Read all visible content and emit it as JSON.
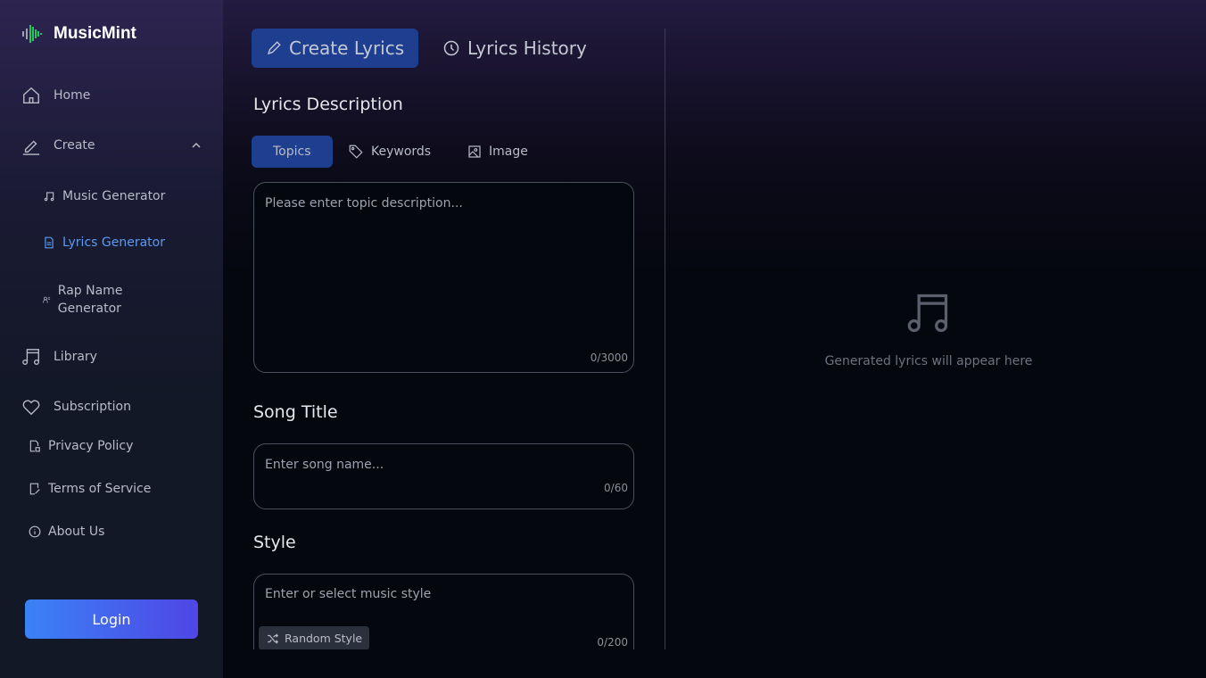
{
  "app": {
    "name": "MusicMint"
  },
  "sidebar": {
    "items": [
      {
        "label": "Home"
      },
      {
        "label": "Create"
      },
      {
        "label": "Music Generator"
      },
      {
        "label": "Lyrics Generator"
      },
      {
        "label": "Rap Name Generator"
      },
      {
        "label": "Library"
      },
      {
        "label": "Subscription"
      },
      {
        "label": "Privacy Policy"
      },
      {
        "label": "Terms of Service"
      },
      {
        "label": "About Us"
      }
    ],
    "login": "Login"
  },
  "tabs": [
    {
      "label": "Create Lyrics"
    },
    {
      "label": "Lyrics History"
    }
  ],
  "form": {
    "description_title": "Lyrics Description",
    "subtabs": [
      {
        "label": "Topics"
      },
      {
        "label": "Keywords"
      },
      {
        "label": "Image"
      }
    ],
    "topic_placeholder": "Please enter topic description...",
    "topic_count": "0/3000",
    "song_title": "Song Title",
    "song_placeholder": "Enter song name...",
    "song_count": "0/60",
    "style_title": "Style",
    "style_placeholder": "Enter or select music style",
    "style_count": "0/200",
    "random_style": "Random Style"
  },
  "output": {
    "empty": "Generated lyrics will appear here"
  }
}
